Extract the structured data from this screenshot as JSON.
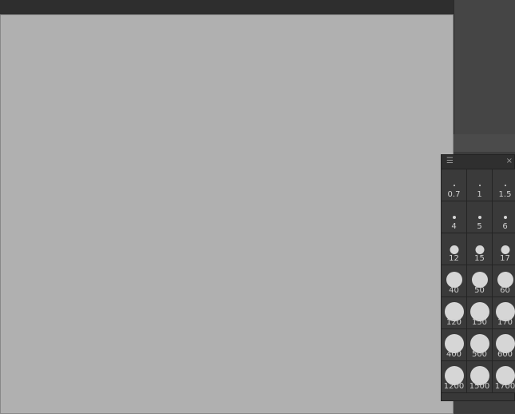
{
  "canvas": {
    "background": "transparency-checkerboard",
    "artwork": "illustration"
  },
  "brush_size_panel": {
    "menu_icon": "hamburger-icon",
    "close_icon": "close-icon",
    "sizes": [
      {
        "label": "0.7",
        "value": 0.7
      },
      {
        "label": "1",
        "value": 1
      },
      {
        "label": "1.5",
        "value": 1.5
      },
      {
        "label": "4",
        "value": 4
      },
      {
        "label": "5",
        "value": 5
      },
      {
        "label": "6",
        "value": 6
      },
      {
        "label": "12",
        "value": 12
      },
      {
        "label": "15",
        "value": 15
      },
      {
        "label": "17",
        "value": 17
      },
      {
        "label": "40",
        "value": 40
      },
      {
        "label": "50",
        "value": 50
      },
      {
        "label": "60",
        "value": 60
      },
      {
        "label": "120",
        "value": 120
      },
      {
        "label": "150",
        "value": 150
      },
      {
        "label": "170",
        "value": 170
      },
      {
        "label": "400",
        "value": 400
      },
      {
        "label": "500",
        "value": 500
      },
      {
        "label": "600",
        "value": 600
      },
      {
        "label": "1200",
        "value": 1200
      },
      {
        "label": "1500",
        "value": 1500
      },
      {
        "label": "1700",
        "value": 1700
      }
    ]
  }
}
